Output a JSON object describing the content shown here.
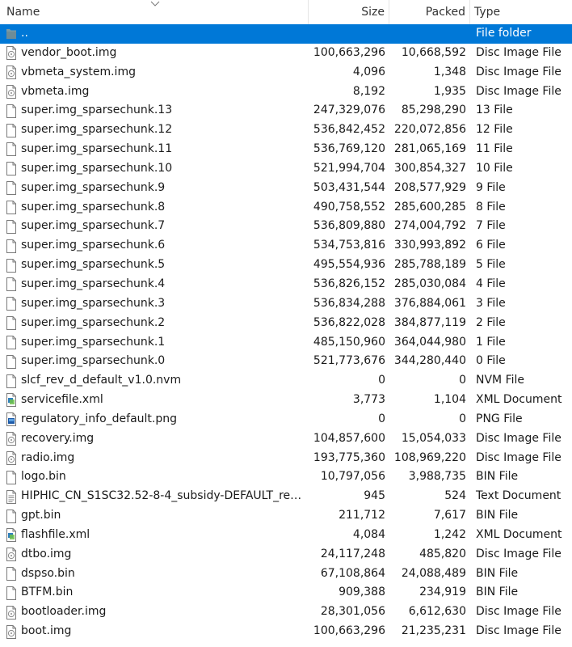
{
  "header": {
    "name": "Name",
    "size": "Size",
    "packed": "Packed",
    "type": "Type"
  },
  "rows": [
    {
      "name": "..",
      "size": "",
      "packed": "",
      "type": "File folder",
      "icon": "folder-icon",
      "selected": true
    },
    {
      "name": "vendor_boot.img",
      "size": "100,663,296",
      "packed": "10,668,592",
      "type": "Disc Image File",
      "icon": "disc-image-icon"
    },
    {
      "name": "vbmeta_system.img",
      "size": "4,096",
      "packed": "1,348",
      "type": "Disc Image File",
      "icon": "disc-image-icon"
    },
    {
      "name": "vbmeta.img",
      "size": "8,192",
      "packed": "1,935",
      "type": "Disc Image File",
      "icon": "disc-image-icon"
    },
    {
      "name": "super.img_sparsechunk.13",
      "size": "247,329,076",
      "packed": "85,298,290",
      "type": "13 File",
      "icon": "blank-file-icon"
    },
    {
      "name": "super.img_sparsechunk.12",
      "size": "536,842,452",
      "packed": "220,072,856",
      "type": "12 File",
      "icon": "blank-file-icon"
    },
    {
      "name": "super.img_sparsechunk.11",
      "size": "536,769,120",
      "packed": "281,065,169",
      "type": "11 File",
      "icon": "blank-file-icon"
    },
    {
      "name": "super.img_sparsechunk.10",
      "size": "521,994,704",
      "packed": "300,854,327",
      "type": "10 File",
      "icon": "blank-file-icon"
    },
    {
      "name": "super.img_sparsechunk.9",
      "size": "503,431,544",
      "packed": "208,577,929",
      "type": "9 File",
      "icon": "blank-file-icon"
    },
    {
      "name": "super.img_sparsechunk.8",
      "size": "490,758,552",
      "packed": "285,600,285",
      "type": "8 File",
      "icon": "blank-file-icon"
    },
    {
      "name": "super.img_sparsechunk.7",
      "size": "536,809,880",
      "packed": "274,004,792",
      "type": "7 File",
      "icon": "blank-file-icon"
    },
    {
      "name": "super.img_sparsechunk.6",
      "size": "534,753,816",
      "packed": "330,993,892",
      "type": "6 File",
      "icon": "blank-file-icon"
    },
    {
      "name": "super.img_sparsechunk.5",
      "size": "495,554,936",
      "packed": "285,788,189",
      "type": "5 File",
      "icon": "blank-file-icon"
    },
    {
      "name": "super.img_sparsechunk.4",
      "size": "536,826,152",
      "packed": "285,030,084",
      "type": "4 File",
      "icon": "blank-file-icon"
    },
    {
      "name": "super.img_sparsechunk.3",
      "size": "536,834,288",
      "packed": "376,884,061",
      "type": "3 File",
      "icon": "blank-file-icon"
    },
    {
      "name": "super.img_sparsechunk.2",
      "size": "536,822,028",
      "packed": "384,877,119",
      "type": "2 File",
      "icon": "blank-file-icon"
    },
    {
      "name": "super.img_sparsechunk.1",
      "size": "485,150,960",
      "packed": "364,044,980",
      "type": "1 File",
      "icon": "blank-file-icon"
    },
    {
      "name": "super.img_sparsechunk.0",
      "size": "521,773,676",
      "packed": "344,280,440",
      "type": "0 File",
      "icon": "blank-file-icon"
    },
    {
      "name": "slcf_rev_d_default_v1.0.nvm",
      "size": "0",
      "packed": "0",
      "type": "NVM File",
      "icon": "blank-file-icon"
    },
    {
      "name": "servicefile.xml",
      "size": "3,773",
      "packed": "1,104",
      "type": "XML Document",
      "icon": "xml-file-icon"
    },
    {
      "name": "regulatory_info_default.png",
      "size": "0",
      "packed": "0",
      "type": "PNG File",
      "icon": "png-file-icon"
    },
    {
      "name": "recovery.img",
      "size": "104,857,600",
      "packed": "15,054,033",
      "type": "Disc Image File",
      "icon": "disc-image-icon"
    },
    {
      "name": "radio.img",
      "size": "193,775,360",
      "packed": "108,969,220",
      "type": "Disc Image File",
      "icon": "disc-image-icon"
    },
    {
      "name": "logo.bin",
      "size": "10,797,056",
      "packed": "3,988,735",
      "type": "BIN File",
      "icon": "blank-file-icon"
    },
    {
      "name": "HIPHIC_CN_S1SC32.52-8-4_subsidy-DEFAULT_regula...",
      "size": "945",
      "packed": "524",
      "type": "Text Document",
      "icon": "text-file-icon"
    },
    {
      "name": "gpt.bin",
      "size": "211,712",
      "packed": "7,617",
      "type": "BIN File",
      "icon": "blank-file-icon"
    },
    {
      "name": "flashfile.xml",
      "size": "4,084",
      "packed": "1,242",
      "type": "XML Document",
      "icon": "xml-file-icon"
    },
    {
      "name": "dtbo.img",
      "size": "24,117,248",
      "packed": "485,820",
      "type": "Disc Image File",
      "icon": "disc-image-icon"
    },
    {
      "name": "dspso.bin",
      "size": "67,108,864",
      "packed": "24,088,489",
      "type": "BIN File",
      "icon": "blank-file-icon"
    },
    {
      "name": "BTFM.bin",
      "size": "909,388",
      "packed": "234,919",
      "type": "BIN File",
      "icon": "blank-file-icon"
    },
    {
      "name": "bootloader.img",
      "size": "28,301,056",
      "packed": "6,612,630",
      "type": "Disc Image File",
      "icon": "disc-image-icon"
    },
    {
      "name": "boot.img",
      "size": "100,663,296",
      "packed": "21,235,231",
      "type": "Disc Image File",
      "icon": "disc-image-icon"
    }
  ],
  "colors": {
    "selection": "#0078d7",
    "text": "#1a1a1a",
    "header_divider": "#e5e5e5"
  }
}
